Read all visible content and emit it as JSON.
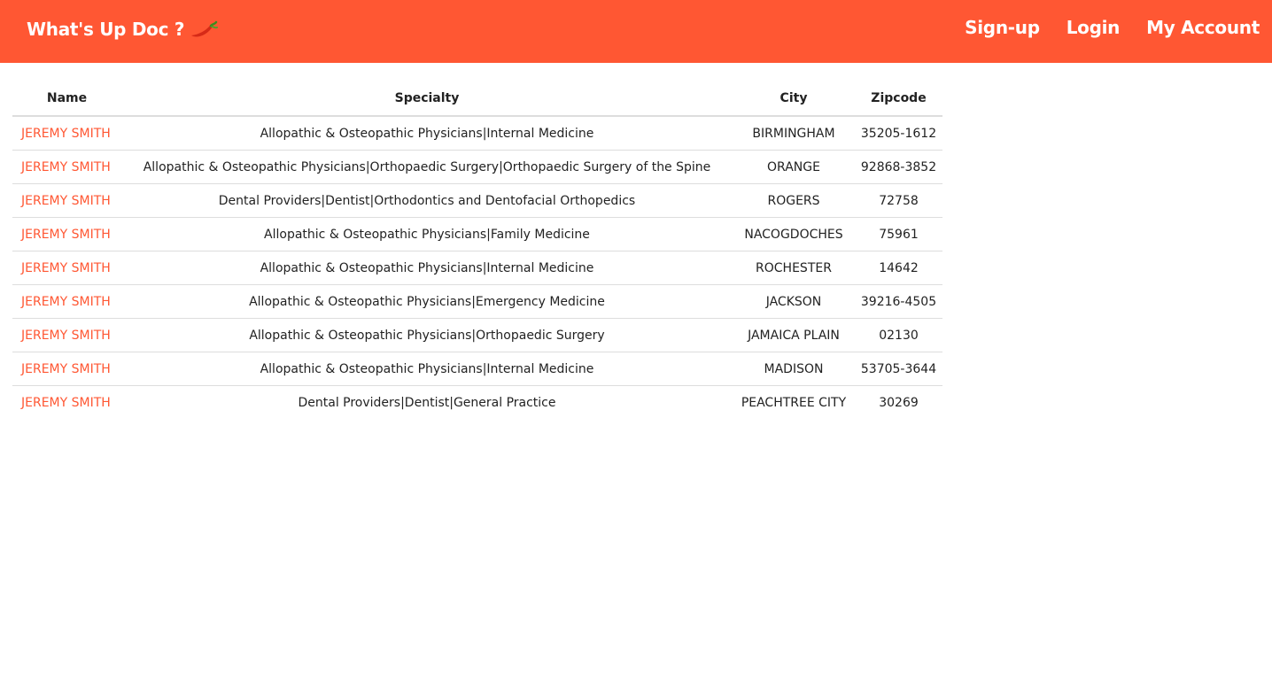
{
  "navbar": {
    "brand": "What's Up Doc ?",
    "brand_icon": "chili-pepper-icon",
    "links": [
      "Sign-up",
      "Login",
      "My Account"
    ],
    "color": "#ff5733"
  },
  "table": {
    "headers": [
      "Name",
      "Specialty",
      "City",
      "Zipcode"
    ],
    "rows": [
      {
        "name": "JEREMY SMITH",
        "specialty": "Allopathic & Osteopathic Physicians|Internal Medicine",
        "city": "BIRMINGHAM",
        "zipcode": "35205-1612"
      },
      {
        "name": "JEREMY SMITH",
        "specialty": "Allopathic & Osteopathic Physicians|Orthopaedic Surgery|Orthopaedic Surgery of the Spine",
        "city": "ORANGE",
        "zipcode": "92868-3852"
      },
      {
        "name": "JEREMY SMITH",
        "specialty": "Dental Providers|Dentist|Orthodontics and Dentofacial Orthopedics",
        "city": "ROGERS",
        "zipcode": "72758"
      },
      {
        "name": "JEREMY SMITH",
        "specialty": "Allopathic & Osteopathic Physicians|Family Medicine",
        "city": "NACOGDOCHES",
        "zipcode": "75961"
      },
      {
        "name": "JEREMY SMITH",
        "specialty": "Allopathic & Osteopathic Physicians|Internal Medicine",
        "city": "ROCHESTER",
        "zipcode": "14642"
      },
      {
        "name": "JEREMY SMITH",
        "specialty": "Allopathic & Osteopathic Physicians|Emergency Medicine",
        "city": "JACKSON",
        "zipcode": "39216-4505"
      },
      {
        "name": "JEREMY SMITH",
        "specialty": "Allopathic & Osteopathic Physicians|Orthopaedic Surgery",
        "city": "JAMAICA PLAIN",
        "zipcode": "02130"
      },
      {
        "name": "JEREMY SMITH",
        "specialty": "Allopathic & Osteopathic Physicians|Internal Medicine",
        "city": "MADISON",
        "zipcode": "53705-3644"
      },
      {
        "name": "JEREMY SMITH",
        "specialty": "Dental Providers|Dentist|General Practice",
        "city": "PEACHTREE CITY",
        "zipcode": "30269"
      }
    ]
  }
}
